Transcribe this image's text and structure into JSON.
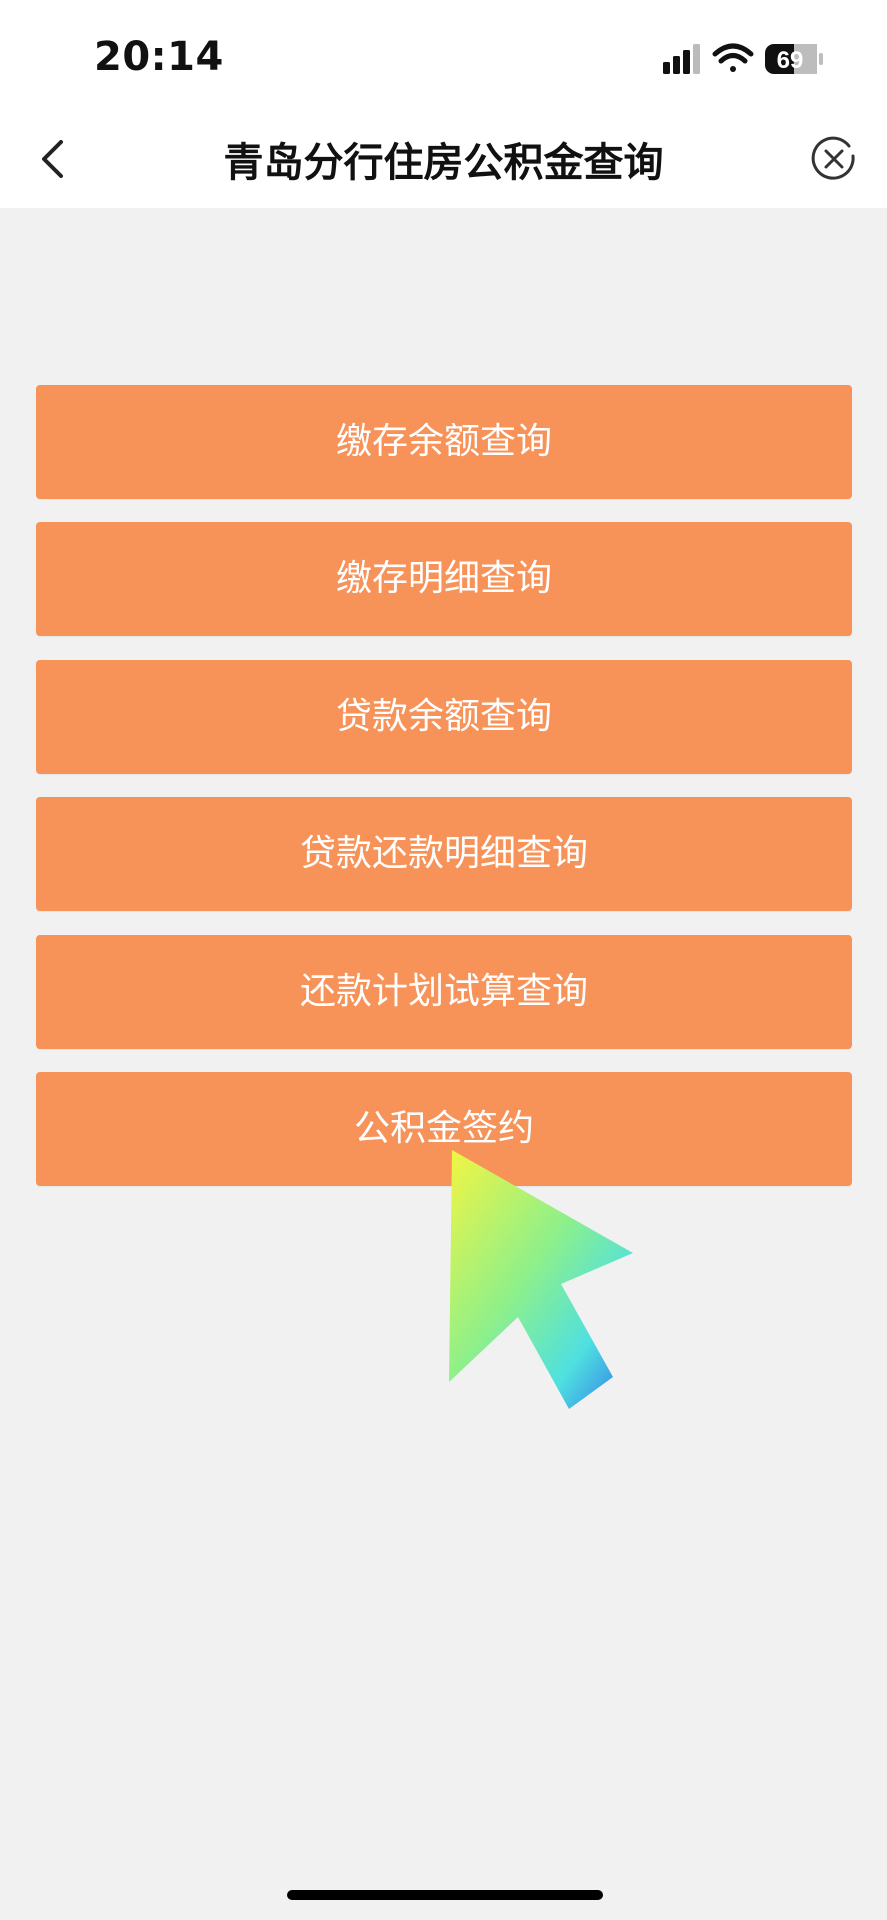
{
  "status_bar": {
    "time": "20:14",
    "battery": "69",
    "icons": [
      "signal-icon",
      "wifi-icon",
      "battery-icon"
    ]
  },
  "nav": {
    "title": "青岛分行住房公积金查询",
    "back_icon": "chevron-left-icon",
    "close_icon": "close-circle-icon"
  },
  "menu": {
    "items": [
      {
        "label": "缴存余额查询"
      },
      {
        "label": "缴存明细查询"
      },
      {
        "label": "贷款余额查询"
      },
      {
        "label": "贷款还款明细查询"
      },
      {
        "label": "还款计划试算查询"
      },
      {
        "label": "公积金签约"
      }
    ]
  },
  "colors": {
    "button_bg": "#f79258",
    "page_bg": "#f1f1f1"
  }
}
